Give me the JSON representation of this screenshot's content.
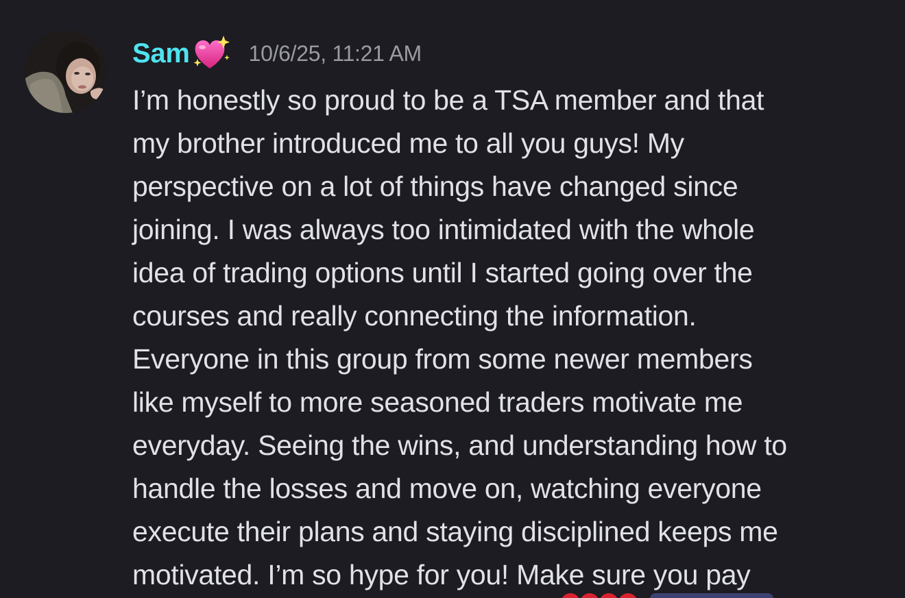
{
  "message": {
    "author": {
      "name": "Sam",
      "name_color": "#4fe3ef",
      "badge_icon": "sparkling-heart-icon"
    },
    "timestamp": "10/6/25, 11:21 AM",
    "lines": [
      "I’m honestly so proud to be a TSA member and that",
      "my brother introduced me to all you guys! My",
      "perspective on a lot of things have changed since",
      "joining. I was always too intimidated with the whole",
      "idea of trading options until I started going over the",
      "courses and really connecting the information.",
      "Everyone in this group from some newer members",
      "like myself to more seasoned traders motivate me",
      "everyday. Seeing the wins, and understanding how to",
      "handle the losses and move on, watching everyone",
      "execute their plans and staying disciplined keeps me",
      "motivated. I’m so hype for you! Make sure you pay"
    ]
  },
  "colors": {
    "background": "#1c1c22",
    "text": "#e1e2e6",
    "timestamp": "#9a9ba3"
  }
}
